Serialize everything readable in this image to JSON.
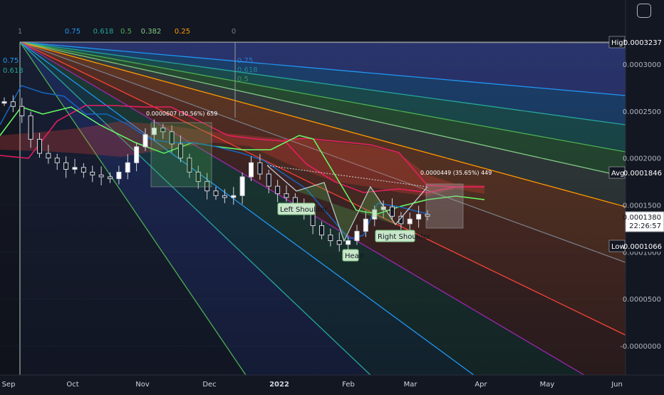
{
  "chart_data": {
    "type": "candlestick",
    "x_tick_labels": [
      "Sep",
      "Oct",
      "Nov",
      "Dec",
      "2022",
      "Feb",
      "Mar",
      "Apr",
      "May",
      "Jun"
    ],
    "y_tick_labels": [
      "0.0003000",
      "0.0002500",
      "0.0002000",
      "0.0001500",
      "0.0001000",
      "0.0000500",
      "-0.0000000"
    ],
    "ylim": [
      -2e-05,
      0.00034
    ],
    "price_tags": [
      {
        "label": "High",
        "value": "0.0003237",
        "color": "#131722"
      },
      {
        "label": "Avg",
        "value": "0.0001846",
        "color": "#131722"
      },
      {
        "label": "Low",
        "value": "0.0001066",
        "color": "#131722"
      }
    ],
    "last_price": {
      "value": "0.0001380",
      "countdown": "22:26:57"
    },
    "fan_levels": [
      {
        "label": "1",
        "color": "#787b86"
      },
      {
        "label": "0.75",
        "color": "#2196f3"
      },
      {
        "label": "0.618",
        "color": "#26a69a"
      },
      {
        "label": "0.5",
        "color": "#4caf50"
      },
      {
        "label": "0.382",
        "color": "#81c784"
      },
      {
        "label": "0.25",
        "color": "#ff9800"
      },
      {
        "label": "0",
        "color": "#787b86"
      }
    ],
    "fan_side_labels": [
      "0.75",
      "0.618"
    ],
    "fan_end_labels": [
      "0.75",
      "0.618",
      "0.5"
    ],
    "annotations": [
      "Left Shoulder",
      "Head",
      "Right Shoulder"
    ],
    "measurements": [
      "0.0000607 (30.56%) 659",
      "0.0000449 (35.65%) 449"
    ],
    "series": [
      {
        "name": "close",
        "values": [
          0.00026,
          0.000255,
          0.000245,
          0.00022,
          0.000205,
          0.0002,
          0.000195,
          0.000188,
          0.00019,
          0.000185,
          0.000182,
          0.00018,
          0.000178,
          0.000185,
          0.000195,
          0.000212,
          0.000225,
          0.000232,
          0.000228,
          0.000215,
          0.0002,
          0.000185,
          0.000175,
          0.000165,
          0.00016,
          0.000158,
          0.00016,
          0.00018,
          0.000195,
          0.000183,
          0.00017,
          0.000162,
          0.000158,
          0.00015,
          0.000142,
          0.000128,
          0.000118,
          0.000112,
          0.000108,
          0.000112,
          0.000122,
          0.000135,
          0.000145,
          0.000148,
          0.000138,
          0.00013,
          0.000135,
          0.00014,
          0.000138
        ]
      }
    ]
  },
  "toolbar": {
    "settings_label": ""
  }
}
